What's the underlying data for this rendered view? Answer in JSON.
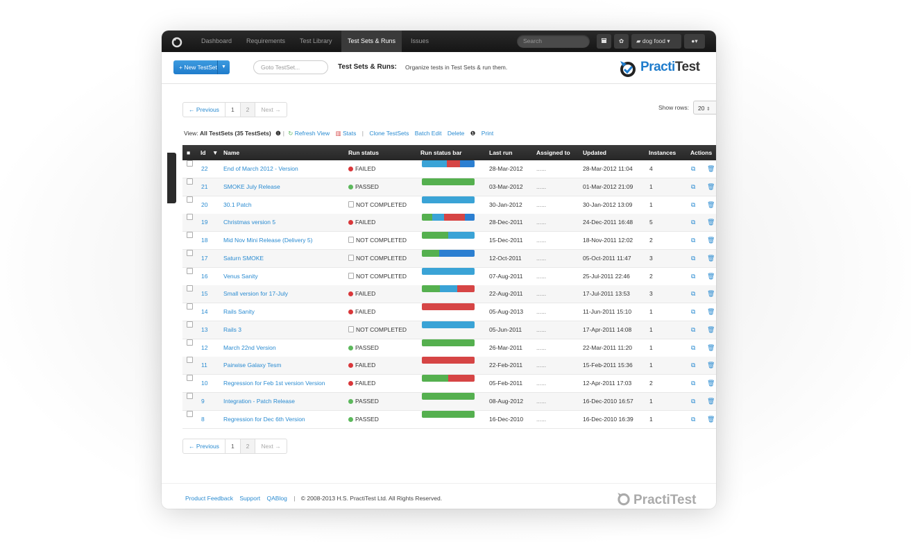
{
  "nav": {
    "items": [
      "Dashboard",
      "Requirements",
      "Test Library",
      "Test Sets & Runs",
      "Issues"
    ],
    "active": "Test Sets & Runs",
    "search_placeholder": "Search",
    "project": "dog food ▾",
    "user_menu": "▾"
  },
  "header": {
    "new_button": "+ New TestSet",
    "goto_placeholder": "Goto TestSet...",
    "title": "Test Sets & Runs:",
    "subtitle": "Organize tests in Test Sets & run them.",
    "brand_prefix": "Practi",
    "brand_suffix": "Test"
  },
  "pager": {
    "previous": "← Previous",
    "page1": "1",
    "page2": "2",
    "next": "Next →"
  },
  "show_rows": {
    "label": "Show rows:",
    "value": "20"
  },
  "viewbar": {
    "view_label": "View:",
    "view_value": "All TestSets (35 TestSets)",
    "refresh": "Refresh View",
    "stats": "Stats",
    "clone": "Clone TestSets",
    "batch_edit": "Batch Edit",
    "delete": "Delete",
    "print": "Print"
  },
  "filter_tree_label": "Filter Tree",
  "table": {
    "columns": [
      "Id",
      "Name",
      "Run status",
      "Run status bar",
      "Last run",
      "Assigned to",
      "Updated",
      "Instances",
      "Actions"
    ],
    "rows": [
      {
        "id": "22",
        "name": "End of March 2012 - Version",
        "status": "FAILED",
        "status_type": "failed",
        "bar": [
          [
            "#3aa3d6",
            48
          ],
          [
            "#d64545",
            24
          ],
          [
            "#2c7fd1",
            28
          ]
        ],
        "last_run": "28-Mar-2012",
        "assigned": "......",
        "updated": "28-Mar-2012 11:04",
        "instances": "4"
      },
      {
        "id": "21",
        "name": "SMOKE July Release",
        "status": "PASSED",
        "status_type": "passed",
        "bar": [
          [
            "#55b04f",
            100
          ]
        ],
        "last_run": "03-Mar-2012",
        "assigned": "......",
        "updated": "01-Mar-2012 21:09",
        "instances": "1"
      },
      {
        "id": "20",
        "name": "30.1 Patch",
        "status": "NOT COMPLETED",
        "status_type": "nc",
        "bar": [
          [
            "#3aa3d6",
            100
          ]
        ],
        "last_run": "30-Jan-2012",
        "assigned": "......",
        "updated": "30-Jan-2012 13:09",
        "instances": "1"
      },
      {
        "id": "19",
        "name": "Christmas version 5",
        "status": "FAILED",
        "status_type": "failed",
        "bar": [
          [
            "#55b04f",
            20
          ],
          [
            "#3aa3d6",
            22
          ],
          [
            "#d64545",
            40
          ],
          [
            "#2c7fd1",
            18
          ]
        ],
        "last_run": "28-Dec-2011",
        "assigned": "......",
        "updated": "24-Dec-2011 16:48",
        "instances": "5"
      },
      {
        "id": "18",
        "name": "Mid Nov Mini Release (Delivery 5)",
        "status": "NOT COMPLETED",
        "status_type": "nc",
        "bar": [
          [
            "#55b04f",
            50
          ],
          [
            "#3aa3d6",
            50
          ]
        ],
        "last_run": "15-Dec-2011",
        "assigned": "......",
        "updated": "18-Nov-2011 12:02",
        "instances": "2"
      },
      {
        "id": "17",
        "name": "Saturn SMOKE",
        "status": "NOT COMPLETED",
        "status_type": "nc",
        "bar": [
          [
            "#55b04f",
            33
          ],
          [
            "#2c7fd1",
            67
          ]
        ],
        "last_run": "12-Oct-2011",
        "assigned": "......",
        "updated": "05-Oct-2011 11:47",
        "instances": "3"
      },
      {
        "id": "16",
        "name": "Venus Sanity",
        "status": "NOT COMPLETED",
        "status_type": "nc",
        "bar": [
          [
            "#3aa3d6",
            100
          ]
        ],
        "last_run": "07-Aug-2011",
        "assigned": "......",
        "updated": "25-Jul-2011 22:46",
        "instances": "2"
      },
      {
        "id": "15",
        "name": "Small version for 17-July",
        "status": "FAILED",
        "status_type": "failed",
        "bar": [
          [
            "#55b04f",
            34
          ],
          [
            "#3aa3d6",
            33
          ],
          [
            "#d64545",
            33
          ]
        ],
        "last_run": "22-Aug-2011",
        "assigned": "......",
        "updated": "17-Jul-2011 13:53",
        "instances": "3"
      },
      {
        "id": "14",
        "name": "Rails Sanity",
        "status": "FAILED",
        "status_type": "failed",
        "bar": [
          [
            "#d64545",
            100
          ]
        ],
        "last_run": "05-Aug-2013",
        "assigned": "......",
        "updated": "11-Jun-2011 15:10",
        "instances": "1"
      },
      {
        "id": "13",
        "name": "Rails 3",
        "status": "NOT COMPLETED",
        "status_type": "nc",
        "bar": [
          [
            "#3aa3d6",
            100
          ]
        ],
        "last_run": "05-Jun-2011",
        "assigned": "......",
        "updated": "17-Apr-2011 14:08",
        "instances": "1"
      },
      {
        "id": "12",
        "name": "March 22nd Version",
        "status": "PASSED",
        "status_type": "passed",
        "bar": [
          [
            "#55b04f",
            100
          ]
        ],
        "last_run": "26-Mar-2011",
        "assigned": "......",
        "updated": "22-Mar-2011 11:20",
        "instances": "1"
      },
      {
        "id": "11",
        "name": "Pairwise Galaxy Tesm",
        "status": "FAILED",
        "status_type": "failed",
        "bar": [
          [
            "#d64545",
            100
          ]
        ],
        "last_run": "22-Feb-2011",
        "assigned": "......",
        "updated": "15-Feb-2011 15:36",
        "instances": "1"
      },
      {
        "id": "10",
        "name": "Regression for Feb 1st version Version",
        "status": "FAILED",
        "status_type": "failed",
        "bar": [
          [
            "#55b04f",
            50
          ],
          [
            "#d64545",
            50
          ]
        ],
        "last_run": "05-Feb-2011",
        "assigned": "......",
        "updated": "12-Apr-2011 17:03",
        "instances": "2"
      },
      {
        "id": "9",
        "name": "Integration - Patch Release",
        "status": "PASSED",
        "status_type": "passed",
        "bar": [
          [
            "#55b04f",
            100
          ]
        ],
        "last_run": "08-Aug-2012",
        "assigned": "......",
        "updated": "16-Dec-2010 16:57",
        "instances": "1"
      },
      {
        "id": "8",
        "name": "Regression for Dec 6th Version",
        "status": "PASSED",
        "status_type": "passed",
        "bar": [
          [
            "#55b04f",
            100
          ]
        ],
        "last_run": "16-Dec-2010",
        "assigned": "......",
        "updated": "16-Dec-2010 16:39",
        "instances": "1"
      }
    ]
  },
  "footer": {
    "links": [
      "Product Feedback",
      "Support",
      "QABlog"
    ],
    "copyright": "© 2008-2013  H.S. PractiTest Ltd. All Rights Reserved.",
    "brand": "PractiTest"
  }
}
